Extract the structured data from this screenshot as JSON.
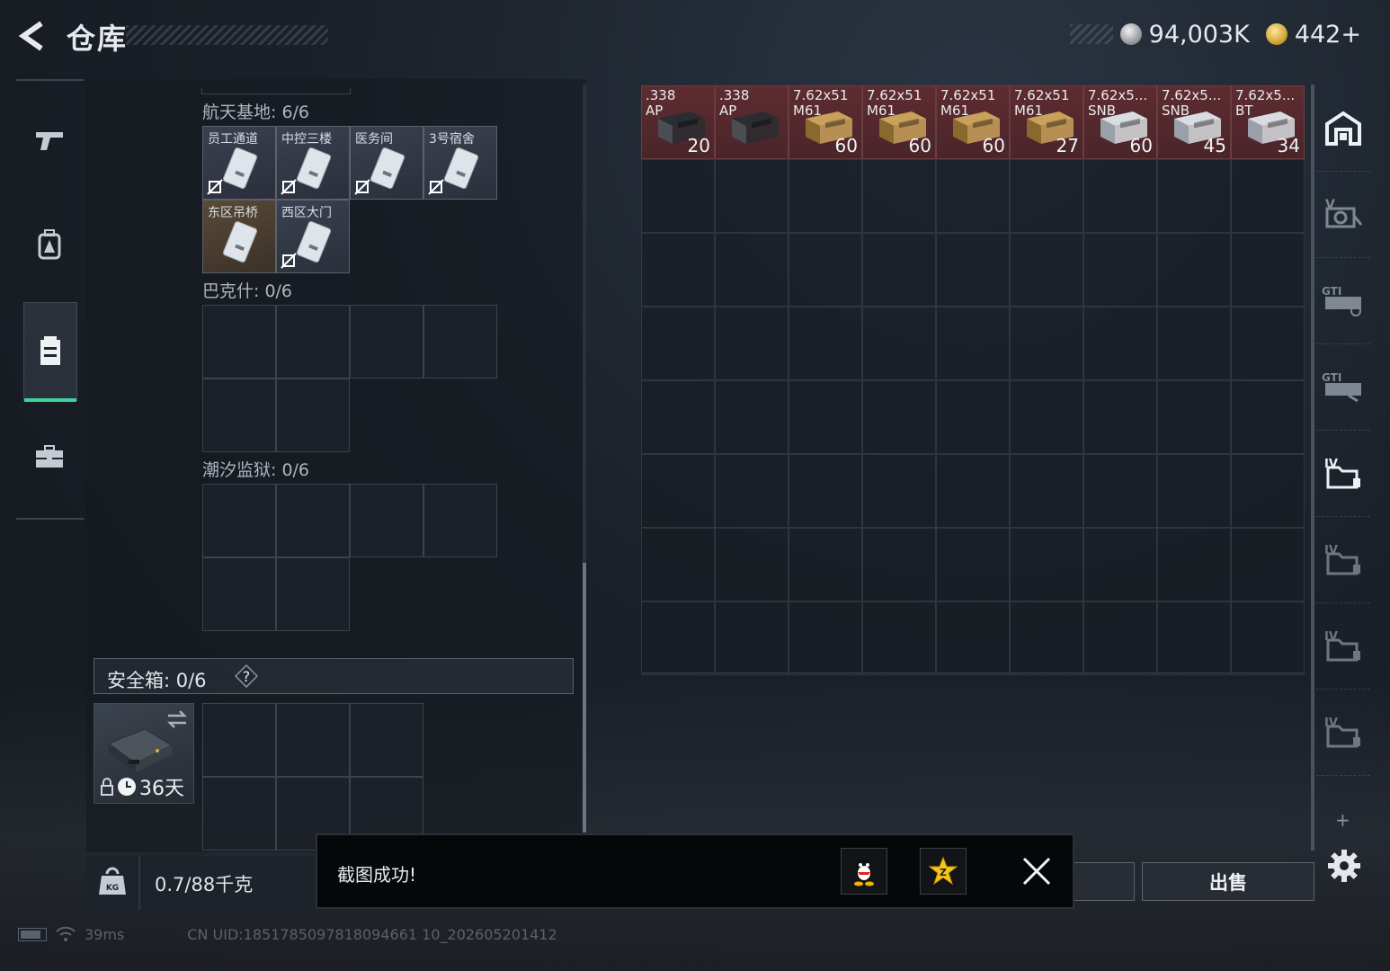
{
  "header": {
    "title": "仓库",
    "silver_amount": "94,003K",
    "gold_amount": "442+"
  },
  "left_nav": {
    "items": [
      "weapon-icon",
      "backpack-icon",
      "locker-icon",
      "toolbox-icon"
    ],
    "active_index": 2
  },
  "keycards": {
    "sections": [
      {
        "label": "航天基地: 6/6",
        "cards": [
          "员工通道",
          "中控三楼",
          "医务间",
          "3号宿舍",
          "东区吊桥",
          "西区大门"
        ]
      },
      {
        "label": "巴克什: 0/6",
        "cards": []
      },
      {
        "label": "潮汐监狱: 0/6",
        "cards": []
      }
    ]
  },
  "safe_box": {
    "label": "安全箱:  0/6",
    "help": "?",
    "days": "36天"
  },
  "weight": {
    "text": "0.7/88千克"
  },
  "storage": {
    "items": [
      {
        "name": ".338\nAP",
        "count": "20",
        "style": "dark"
      },
      {
        "name": ".338\nAP",
        "count": "",
        "style": "dark"
      },
      {
        "name": "7.62x51\nM61",
        "count": "60",
        "style": "gold"
      },
      {
        "name": "7.62x51\nM61",
        "count": "60",
        "style": "gold"
      },
      {
        "name": "7.62x51\nM61",
        "count": "60",
        "style": "gold"
      },
      {
        "name": "7.62x51\nM61",
        "count": "27",
        "style": "gold"
      },
      {
        "name": "7.62x5...\nSNB",
        "count": "60",
        "style": "silver"
      },
      {
        "name": "7.62x5...\nSNB",
        "count": "45",
        "style": "silver"
      },
      {
        "name": "7.62x5...\nBT",
        "count": "34",
        "style": "silver"
      }
    ]
  },
  "right_tabs": [
    "safe-zone-icon",
    "v-container-icon",
    "gti-container-icon",
    "gti-container-2-icon",
    "iv-folder-icon",
    "iv-folder-2-icon",
    "iv-folder-3-icon",
    "iv-folder-4-icon"
  ],
  "buttons": {
    "sell": "出售"
  },
  "toast": {
    "message": "截图成功!"
  },
  "footer": {
    "ping": "39ms",
    "uid": "CN UID:1851785097818094661 10_202605201412"
  },
  "colors": {
    "accent_green": "#3bd39a",
    "ammo_red": "#5e2c31"
  }
}
